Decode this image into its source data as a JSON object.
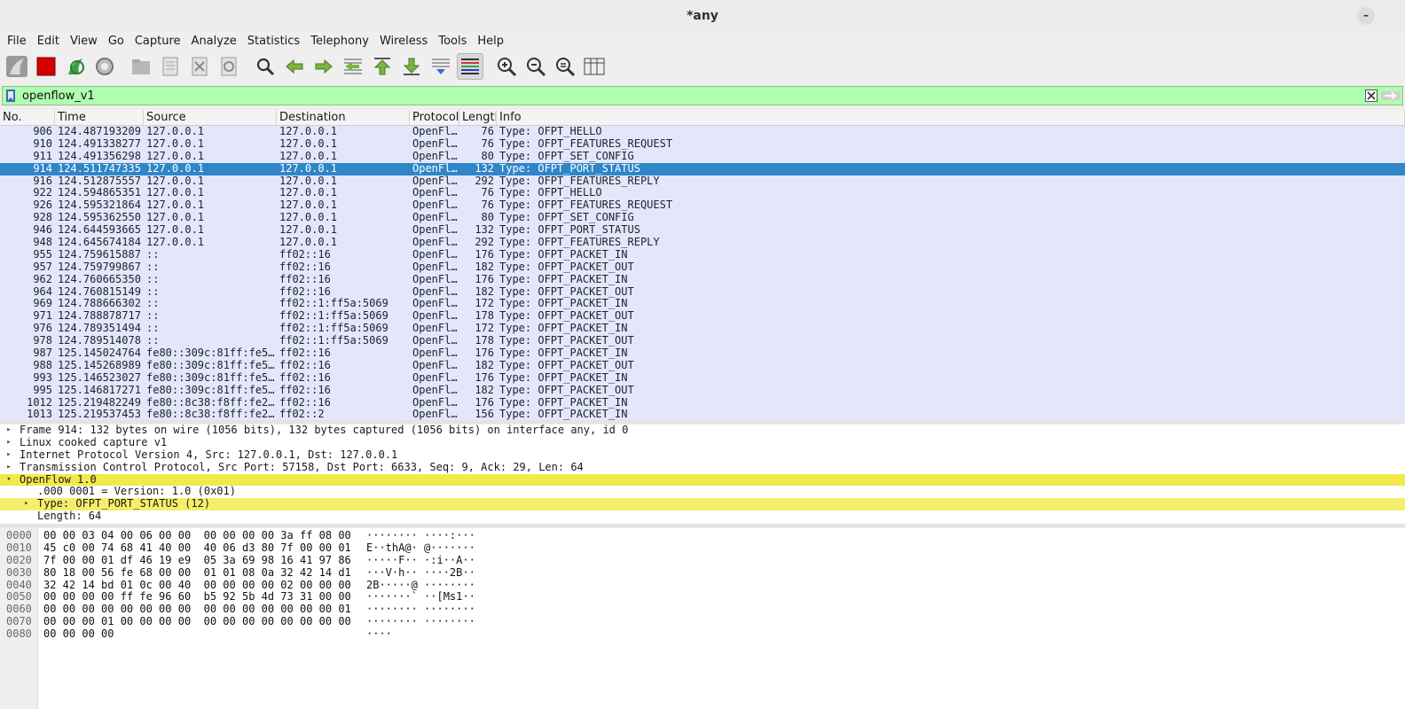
{
  "window": {
    "title": "*any",
    "minimize_label": "–"
  },
  "menu": [
    "File",
    "Edit",
    "View",
    "Go",
    "Capture",
    "Analyze",
    "Statistics",
    "Telephony",
    "Wireless",
    "Tools",
    "Help"
  ],
  "toolbar": {
    "icons": [
      "shark-fin-start-icon",
      "stop-capture-icon",
      "restart-capture-icon",
      "capture-options-icon",
      "open-file-icon",
      "save-file-icon",
      "close-file-icon",
      "reload-file-icon",
      "find-packet-icon",
      "go-back-icon",
      "go-forward-icon",
      "go-to-packet-icon",
      "go-first-icon",
      "go-last-icon",
      "auto-scroll-icon",
      "colorize-icon",
      "zoom-in-icon",
      "zoom-out-icon",
      "zoom-normal-icon",
      "resize-columns-icon"
    ]
  },
  "filter": {
    "value": "openflow_v1",
    "bg_color": "#afffaf"
  },
  "packet_list": {
    "columns": [
      "No.",
      "Time",
      "Source",
      "Destination",
      "Protocol",
      "Length",
      "Info"
    ],
    "selected_no": "914",
    "rows": [
      [
        "906",
        "124.487193209",
        "127.0.0.1",
        "127.0.0.1",
        "OpenFl…",
        "76",
        "Type: OFPT_HELLO"
      ],
      [
        "910",
        "124.491338277",
        "127.0.0.1",
        "127.0.0.1",
        "OpenFl…",
        "76",
        "Type: OFPT_FEATURES_REQUEST"
      ],
      [
        "911",
        "124.491356298",
        "127.0.0.1",
        "127.0.0.1",
        "OpenFl…",
        "80",
        "Type: OFPT_SET_CONFIG"
      ],
      [
        "914",
        "124.511747335",
        "127.0.0.1",
        "127.0.0.1",
        "OpenFl…",
        "132",
        "Type: OFPT_PORT_STATUS"
      ],
      [
        "916",
        "124.512875557",
        "127.0.0.1",
        "127.0.0.1",
        "OpenFl…",
        "292",
        "Type: OFPT_FEATURES_REPLY"
      ],
      [
        "922",
        "124.594865351",
        "127.0.0.1",
        "127.0.0.1",
        "OpenFl…",
        "76",
        "Type: OFPT_HELLO"
      ],
      [
        "926",
        "124.595321864",
        "127.0.0.1",
        "127.0.0.1",
        "OpenFl…",
        "76",
        "Type: OFPT_FEATURES_REQUEST"
      ],
      [
        "928",
        "124.595362550",
        "127.0.0.1",
        "127.0.0.1",
        "OpenFl…",
        "80",
        "Type: OFPT_SET_CONFIG"
      ],
      [
        "946",
        "124.644593665",
        "127.0.0.1",
        "127.0.0.1",
        "OpenFl…",
        "132",
        "Type: OFPT_PORT_STATUS"
      ],
      [
        "948",
        "124.645674184",
        "127.0.0.1",
        "127.0.0.1",
        "OpenFl…",
        "292",
        "Type: OFPT_FEATURES_REPLY"
      ],
      [
        "955",
        "124.759615887",
        "::",
        "ff02::16",
        "OpenFl…",
        "176",
        "Type: OFPT_PACKET_IN"
      ],
      [
        "957",
        "124.759799867",
        "::",
        "ff02::16",
        "OpenFl…",
        "182",
        "Type: OFPT_PACKET_OUT"
      ],
      [
        "962",
        "124.760665350",
        "::",
        "ff02::16",
        "OpenFl…",
        "176",
        "Type: OFPT_PACKET_IN"
      ],
      [
        "964",
        "124.760815149",
        "::",
        "ff02::16",
        "OpenFl…",
        "182",
        "Type: OFPT_PACKET_OUT"
      ],
      [
        "969",
        "124.788666302",
        "::",
        "ff02::1:ff5a:5069",
        "OpenFl…",
        "172",
        "Type: OFPT_PACKET_IN"
      ],
      [
        "971",
        "124.788878717",
        "::",
        "ff02::1:ff5a:5069",
        "OpenFl…",
        "178",
        "Type: OFPT_PACKET_OUT"
      ],
      [
        "976",
        "124.789351494",
        "::",
        "ff02::1:ff5a:5069",
        "OpenFl…",
        "172",
        "Type: OFPT_PACKET_IN"
      ],
      [
        "978",
        "124.789514078",
        "::",
        "ff02::1:ff5a:5069",
        "OpenFl…",
        "178",
        "Type: OFPT_PACKET_OUT"
      ],
      [
        "987",
        "125.145024764",
        "fe80::309c:81ff:fe5…",
        "ff02::16",
        "OpenFl…",
        "176",
        "Type: OFPT_PACKET_IN"
      ],
      [
        "988",
        "125.145268989",
        "fe80::309c:81ff:fe5…",
        "ff02::16",
        "OpenFl…",
        "182",
        "Type: OFPT_PACKET_OUT"
      ],
      [
        "993",
        "125.146523027",
        "fe80::309c:81ff:fe5…",
        "ff02::16",
        "OpenFl…",
        "176",
        "Type: OFPT_PACKET_IN"
      ],
      [
        "995",
        "125.146817271",
        "fe80::309c:81ff:fe5…",
        "ff02::16",
        "OpenFl…",
        "182",
        "Type: OFPT_PACKET_OUT"
      ],
      [
        "1012",
        "125.219482249",
        "fe80::8c38:f8ff:fe2…",
        "ff02::16",
        "OpenFl…",
        "176",
        "Type: OFPT_PACKET_IN"
      ],
      [
        "1013",
        "125.219537453",
        "fe80::8c38:f8ff:fe2…",
        "ff02::2",
        "OpenFl…",
        "156",
        "Type: OFPT_PACKET_IN"
      ]
    ]
  },
  "details": [
    {
      "text": "Frame 914: 132 bytes on wire (1056 bits), 132 bytes captured (1056 bits) on interface any, id 0",
      "expander": "right",
      "level": 0,
      "highlight": ""
    },
    {
      "text": "Linux cooked capture v1",
      "expander": "right",
      "level": 0,
      "highlight": ""
    },
    {
      "text": "Internet Protocol Version 4, Src: 127.0.0.1, Dst: 127.0.0.1",
      "expander": "right",
      "level": 0,
      "highlight": ""
    },
    {
      "text": "Transmission Control Protocol, Src Port: 57158, Dst Port: 6633, Seq: 9, Ack: 29, Len: 64",
      "expander": "right",
      "level": 0,
      "highlight": ""
    },
    {
      "text": "OpenFlow 1.0",
      "expander": "down",
      "level": 0,
      "highlight": "hl"
    },
    {
      "text": ".000 0001 = Version: 1.0 (0x01)",
      "expander": "",
      "level": 1,
      "highlight": ""
    },
    {
      "text": "Type: OFPT_PORT_STATUS (12)",
      "expander": "right",
      "level": 1,
      "highlight": "hl2"
    },
    {
      "text": "Length: 64",
      "expander": "",
      "level": 1,
      "highlight": ""
    }
  ],
  "hex": [
    {
      "offset": "0000",
      "bytes": "00 00 03 04 00 06 00 00  00 00 00 00 3a ff 08 00",
      "ascii": "········ ····:···"
    },
    {
      "offset": "0010",
      "bytes": "45 c0 00 74 68 41 40 00  40 06 d3 80 7f 00 00 01",
      "ascii": "E··thA@· @·······"
    },
    {
      "offset": "0020",
      "bytes": "7f 00 00 01 df 46 19 e9  05 3a 69 98 16 41 97 86",
      "ascii": "·····F·· ·:i··A··"
    },
    {
      "offset": "0030",
      "bytes": "80 18 00 56 fe 68 00 00  01 01 08 0a 32 42 14 d1",
      "ascii": "···V·h·· ····2B··"
    },
    {
      "offset": "0040",
      "bytes": "32 42 14 bd 01 0c 00 40  00 00 00 00 02 00 00 00",
      "ascii": "2B·····@ ········"
    },
    {
      "offset": "0050",
      "bytes": "00 00 00 00 ff fe 96 60  b5 92 5b 4d 73 31 00 00",
      "ascii": "·······` ··[Ms1··"
    },
    {
      "offset": "0060",
      "bytes": "00 00 00 00 00 00 00 00  00 00 00 00 00 00 00 01",
      "ascii": "········ ········"
    },
    {
      "offset": "0070",
      "bytes": "00 00 00 01 00 00 00 00  00 00 00 00 00 00 00 00",
      "ascii": "········ ········"
    },
    {
      "offset": "0080",
      "bytes": "00 00 00 00",
      "ascii": "····"
    }
  ]
}
